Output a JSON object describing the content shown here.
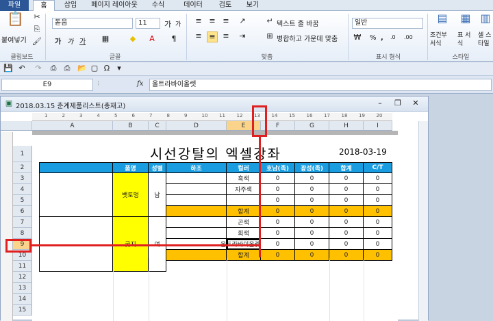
{
  "tabs": [
    "파일",
    "홈",
    "삽입",
    "페이지 레이아웃",
    "수식",
    "데이터",
    "검토",
    "보기"
  ],
  "ribbon": {
    "paste": "붙여넣기",
    "clipboard": "클립보드",
    "font_name": "돋움",
    "font_size": "11",
    "font": "글꼴",
    "wrap_text": "텍스트 줄 바꿈",
    "merge_center": "병합하고 가운데 맞춤",
    "alignment": "맞춤",
    "number_format": "일반",
    "number": "표시 형식",
    "cond_format": "조건부 서식",
    "table_format": "표 서식",
    "cell_style": "셀 스타일",
    "styles": "스타일",
    "bold": "가",
    "italic": "가",
    "underline": "가",
    "grow": "가",
    "shrink": "가",
    "pct": "%",
    "comma": ",",
    "increase_dec": ".0",
    "decrease_dec": ".00"
  },
  "formula_bar": {
    "name_box": "E9",
    "fx": "fx",
    "value": "울트라바이올렛"
  },
  "workbook": {
    "title": "2018.03.15 춘계제품리스트(총재고)",
    "columns": [
      "A",
      "B",
      "C",
      "D",
      "E",
      "F",
      "G",
      "H",
      "I"
    ],
    "rows": [
      "1",
      "2",
      "3",
      "4",
      "5",
      "6",
      "7",
      "8",
      "9",
      "10",
      "11",
      "12",
      "13",
      "14",
      "15"
    ],
    "ruler_marks": [
      "1",
      "2",
      "3",
      "4",
      "5",
      "6",
      "7",
      "8",
      "9",
      "10",
      "11",
      "12",
      "13",
      "14",
      "15",
      "16",
      "17",
      "18",
      "19",
      "20"
    ]
  },
  "sheet": {
    "title": "시선강탈의 엑셀강좌",
    "date": "2018-03-19",
    "headers": [
      "품명",
      "성별",
      "하조",
      "컬러",
      "호남(족)",
      "광성(족)",
      "합계",
      "C/T"
    ],
    "group1": {
      "name": "뱃토멍",
      "gender": "남",
      "colors": [
        "흑색",
        "자주색",
        ""
      ],
      "total": "합계"
    },
    "group2": {
      "name": "굿지",
      "gender": "여",
      "colors": [
        "곤색",
        "회색",
        "울트라바이올렛"
      ],
      "total": "합계"
    },
    "zero": "0"
  }
}
